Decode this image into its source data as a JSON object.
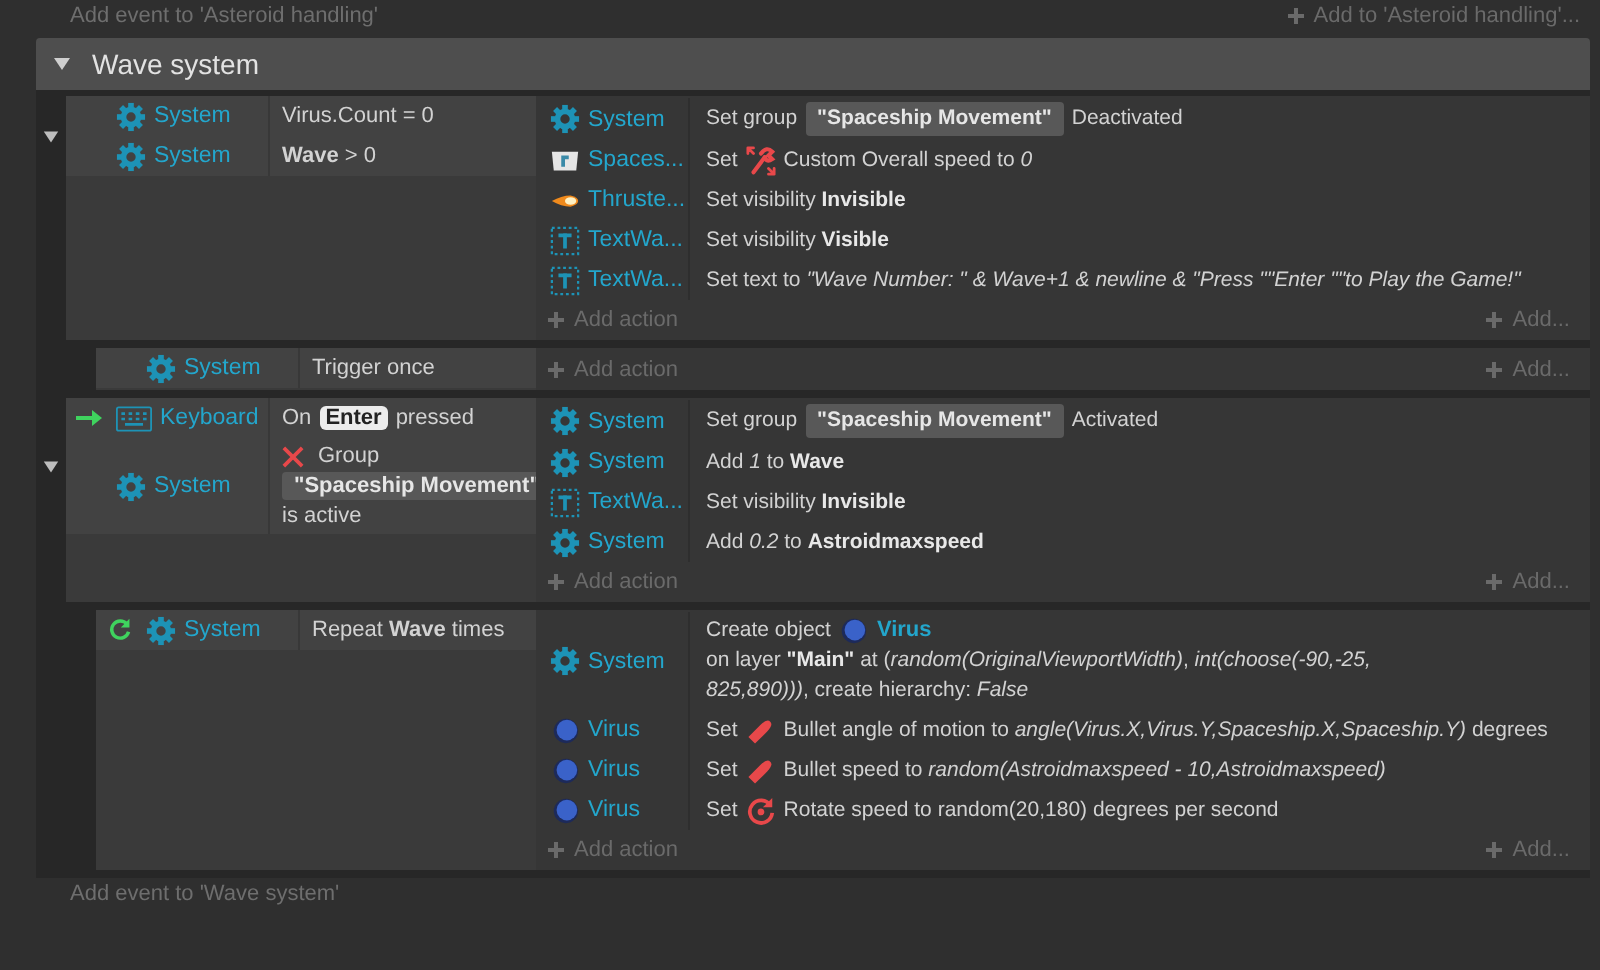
{
  "top_bar": {
    "add_event": "Add event to 'Asteroid handling'",
    "add_to": "Add to 'Asteroid handling'..."
  },
  "group": {
    "title": "Wave system",
    "expanded": true,
    "events": [
      {
        "expanded": true,
        "conditions": [
          {
            "object": "System",
            "kind": "system",
            "trigger": false,
            "loop": false,
            "inverted": false,
            "segments": [
              {
                "kind": "text",
                "text": "Virus.Count = 0"
              }
            ]
          },
          {
            "object": "System",
            "kind": "system",
            "trigger": false,
            "loop": false,
            "inverted": false,
            "segments": [
              {
                "kind": "text",
                "text": "**Wave** > 0"
              }
            ]
          }
        ],
        "actions": [
          {
            "object": "System",
            "kind": "system",
            "segments": [
              {
                "kind": "text",
                "text": "Set group"
              },
              {
                "kind": "chip",
                "text": "\"Spaceship Movement\""
              },
              {
                "kind": "text",
                "text": "Deactivated"
              }
            ]
          },
          {
            "object": "Spaces...",
            "kind": "sprite",
            "segments": [
              {
                "kind": "text",
                "text": "Set"
              },
              {
                "kind": "wrench"
              },
              {
                "kind": "text",
                "text": "Custom Overall speed to *0*"
              }
            ]
          },
          {
            "object": "Thruste...",
            "kind": "thruster",
            "segments": [
              {
                "kind": "text",
                "text": "Set visibility **Invisible**"
              }
            ]
          },
          {
            "object": "TextWa...",
            "kind": "text",
            "segments": [
              {
                "kind": "text",
                "text": "Set visibility **Visible**"
              }
            ]
          },
          {
            "object": "TextWa...",
            "kind": "text",
            "segments": [
              {
                "kind": "text",
                "text": "Set text to *\"Wave Number: \" & Wave+1 & newline & \"Press \"\"Enter \"\"to Play the Game!\"*"
              }
            ]
          }
        ],
        "add_action": "Add action",
        "add_more": "Add...",
        "children": [
          {
            "conditions": [
              {
                "object": "System",
                "kind": "system",
                "trigger": false,
                "loop": false,
                "inverted": false,
                "segments": [
                  {
                    "kind": "text",
                    "text": "Trigger once"
                  }
                ]
              }
            ],
            "add_action": "Add action",
            "add_more": "Add..."
          }
        ]
      },
      {
        "expanded": true,
        "conditions": [
          {
            "object": "Keyboard",
            "kind": "keyboard",
            "trigger": true,
            "loop": false,
            "inverted": false,
            "segments": [
              {
                "kind": "text",
                "text": "On"
              },
              {
                "kind": "key",
                "text": "Enter"
              },
              {
                "kind": "text",
                "text": "pressed"
              }
            ]
          },
          {
            "object": "System",
            "kind": "system",
            "trigger": false,
            "loop": false,
            "inverted": true,
            "segments": [
              {
                "kind": "text",
                "text": "Group"
              },
              {
                "kind": "chip",
                "text": "\"Spaceship Movement\""
              },
              {
                "kind": "text",
                "text": "is active"
              }
            ]
          }
        ],
        "actions": [
          {
            "object": "System",
            "kind": "system",
            "segments": [
              {
                "kind": "text",
                "text": "Set group"
              },
              {
                "kind": "chip",
                "text": "\"Spaceship Movement\""
              },
              {
                "kind": "text",
                "text": "Activated"
              }
            ]
          },
          {
            "object": "System",
            "kind": "system",
            "segments": [
              {
                "kind": "text",
                "text": "Add *1* to **Wave**"
              }
            ]
          },
          {
            "object": "TextWa...",
            "kind": "text",
            "segments": [
              {
                "kind": "text",
                "text": "Set visibility **Invisible**"
              }
            ]
          },
          {
            "object": "System",
            "kind": "system",
            "segments": [
              {
                "kind": "text",
                "text": "Add *0.2* to **Astroidmaxspeed**"
              }
            ]
          }
        ],
        "add_action": "Add action",
        "add_more": "Add...",
        "children": [
          {
            "conditions": [
              {
                "object": "System",
                "kind": "system",
                "trigger": false,
                "loop": true,
                "inverted": false,
                "segments": [
                  {
                    "kind": "text",
                    "text": "Repeat **Wave** times"
                  }
                ]
              }
            ],
            "actions": [
              {
                "object": "System",
                "kind": "system",
                "segments": [
                  {
                    "kind": "text",
                    "text": "Create object"
                  },
                  {
                    "kind": "virus",
                    "text": "Virus"
                  },
                  {
                    "kind": "text",
                    "text": "on layer **\"Main\"** at (*random(OriginalViewportWidth)*, *int(choose(-90,-25,*"
                  },
                  {
                    "kind": "text",
                    "text": "*825,890)))*, create hierarchy: *False*"
                  }
                ]
              },
              {
                "object": "Virus",
                "kind": "virus",
                "segments": [
                  {
                    "kind": "text",
                    "text": "Set"
                  },
                  {
                    "kind": "bullet"
                  },
                  {
                    "kind": "text",
                    "text": "Bullet angle of motion to *angle(Virus.X,Virus.Y,Spaceship.X,Spaceship.Y)* degrees"
                  }
                ]
              },
              {
                "object": "Virus",
                "kind": "virus",
                "segments": [
                  {
                    "kind": "text",
                    "text": "Set"
                  },
                  {
                    "kind": "bullet"
                  },
                  {
                    "kind": "text",
                    "text": "Bullet speed to *random(Astroidmaxspeed - 10,Astroidmaxspeed)*"
                  }
                ]
              },
              {
                "object": "Virus",
                "kind": "virus",
                "segments": [
                  {
                    "kind": "text",
                    "text": "Set"
                  },
                  {
                    "kind": "rotate"
                  },
                  {
                    "kind": "text",
                    "text": "Rotate speed to random(20,180) degrees per second"
                  }
                ]
              }
            ],
            "add_action": "Add action",
            "add_more": "Add..."
          }
        ]
      }
    ],
    "add_event": "Add event to 'Wave system'"
  }
}
